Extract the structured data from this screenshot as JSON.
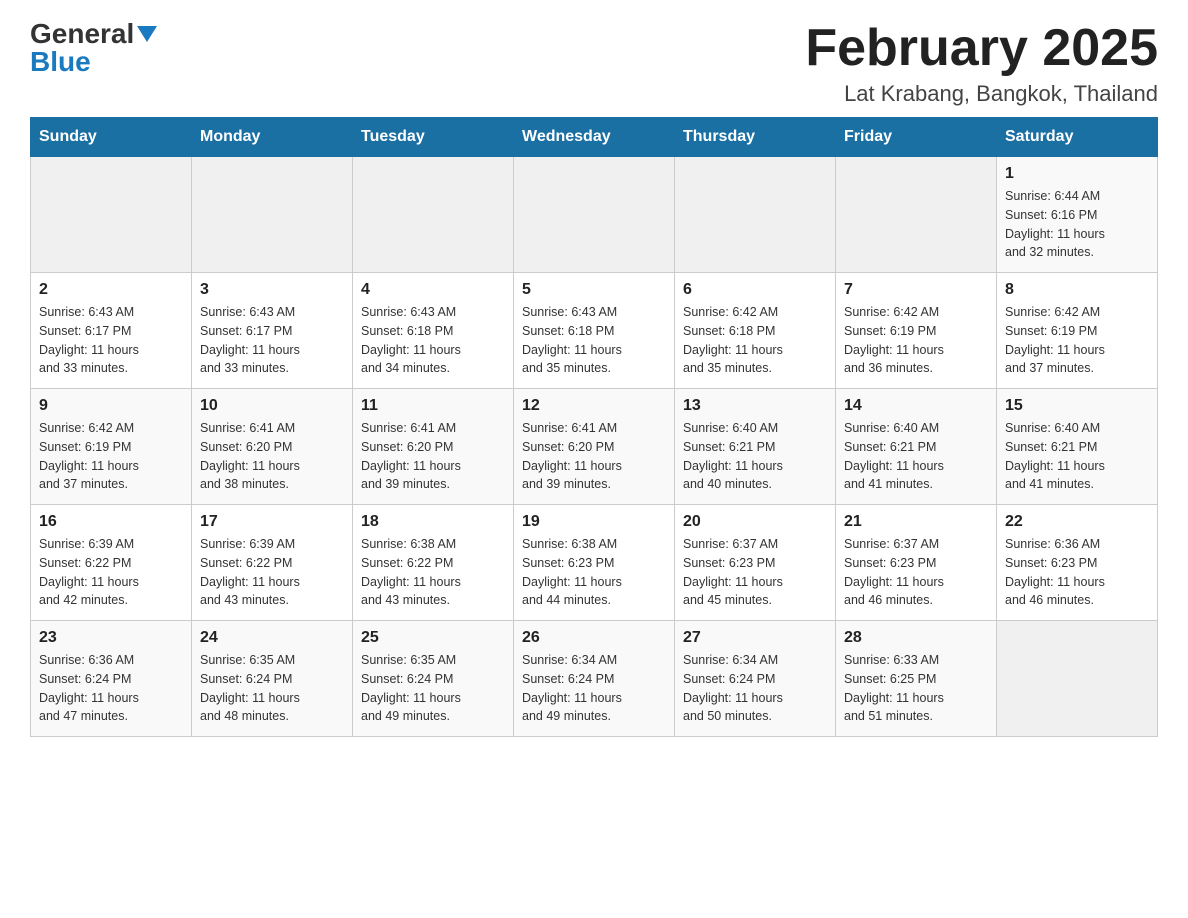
{
  "logo": {
    "general": "General",
    "blue": "Blue"
  },
  "header": {
    "title": "February 2025",
    "location": "Lat Krabang, Bangkok, Thailand"
  },
  "weekdays": [
    "Sunday",
    "Monday",
    "Tuesday",
    "Wednesday",
    "Thursday",
    "Friday",
    "Saturday"
  ],
  "weeks": [
    [
      {
        "day": "",
        "info": ""
      },
      {
        "day": "",
        "info": ""
      },
      {
        "day": "",
        "info": ""
      },
      {
        "day": "",
        "info": ""
      },
      {
        "day": "",
        "info": ""
      },
      {
        "day": "",
        "info": ""
      },
      {
        "day": "1",
        "info": "Sunrise: 6:44 AM\nSunset: 6:16 PM\nDaylight: 11 hours\nand 32 minutes."
      }
    ],
    [
      {
        "day": "2",
        "info": "Sunrise: 6:43 AM\nSunset: 6:17 PM\nDaylight: 11 hours\nand 33 minutes."
      },
      {
        "day": "3",
        "info": "Sunrise: 6:43 AM\nSunset: 6:17 PM\nDaylight: 11 hours\nand 33 minutes."
      },
      {
        "day": "4",
        "info": "Sunrise: 6:43 AM\nSunset: 6:18 PM\nDaylight: 11 hours\nand 34 minutes."
      },
      {
        "day": "5",
        "info": "Sunrise: 6:43 AM\nSunset: 6:18 PM\nDaylight: 11 hours\nand 35 minutes."
      },
      {
        "day": "6",
        "info": "Sunrise: 6:42 AM\nSunset: 6:18 PM\nDaylight: 11 hours\nand 35 minutes."
      },
      {
        "day": "7",
        "info": "Sunrise: 6:42 AM\nSunset: 6:19 PM\nDaylight: 11 hours\nand 36 minutes."
      },
      {
        "day": "8",
        "info": "Sunrise: 6:42 AM\nSunset: 6:19 PM\nDaylight: 11 hours\nand 37 minutes."
      }
    ],
    [
      {
        "day": "9",
        "info": "Sunrise: 6:42 AM\nSunset: 6:19 PM\nDaylight: 11 hours\nand 37 minutes."
      },
      {
        "day": "10",
        "info": "Sunrise: 6:41 AM\nSunset: 6:20 PM\nDaylight: 11 hours\nand 38 minutes."
      },
      {
        "day": "11",
        "info": "Sunrise: 6:41 AM\nSunset: 6:20 PM\nDaylight: 11 hours\nand 39 minutes."
      },
      {
        "day": "12",
        "info": "Sunrise: 6:41 AM\nSunset: 6:20 PM\nDaylight: 11 hours\nand 39 minutes."
      },
      {
        "day": "13",
        "info": "Sunrise: 6:40 AM\nSunset: 6:21 PM\nDaylight: 11 hours\nand 40 minutes."
      },
      {
        "day": "14",
        "info": "Sunrise: 6:40 AM\nSunset: 6:21 PM\nDaylight: 11 hours\nand 41 minutes."
      },
      {
        "day": "15",
        "info": "Sunrise: 6:40 AM\nSunset: 6:21 PM\nDaylight: 11 hours\nand 41 minutes."
      }
    ],
    [
      {
        "day": "16",
        "info": "Sunrise: 6:39 AM\nSunset: 6:22 PM\nDaylight: 11 hours\nand 42 minutes."
      },
      {
        "day": "17",
        "info": "Sunrise: 6:39 AM\nSunset: 6:22 PM\nDaylight: 11 hours\nand 43 minutes."
      },
      {
        "day": "18",
        "info": "Sunrise: 6:38 AM\nSunset: 6:22 PM\nDaylight: 11 hours\nand 43 minutes."
      },
      {
        "day": "19",
        "info": "Sunrise: 6:38 AM\nSunset: 6:23 PM\nDaylight: 11 hours\nand 44 minutes."
      },
      {
        "day": "20",
        "info": "Sunrise: 6:37 AM\nSunset: 6:23 PM\nDaylight: 11 hours\nand 45 minutes."
      },
      {
        "day": "21",
        "info": "Sunrise: 6:37 AM\nSunset: 6:23 PM\nDaylight: 11 hours\nand 46 minutes."
      },
      {
        "day": "22",
        "info": "Sunrise: 6:36 AM\nSunset: 6:23 PM\nDaylight: 11 hours\nand 46 minutes."
      }
    ],
    [
      {
        "day": "23",
        "info": "Sunrise: 6:36 AM\nSunset: 6:24 PM\nDaylight: 11 hours\nand 47 minutes."
      },
      {
        "day": "24",
        "info": "Sunrise: 6:35 AM\nSunset: 6:24 PM\nDaylight: 11 hours\nand 48 minutes."
      },
      {
        "day": "25",
        "info": "Sunrise: 6:35 AM\nSunset: 6:24 PM\nDaylight: 11 hours\nand 49 minutes."
      },
      {
        "day": "26",
        "info": "Sunrise: 6:34 AM\nSunset: 6:24 PM\nDaylight: 11 hours\nand 49 minutes."
      },
      {
        "day": "27",
        "info": "Sunrise: 6:34 AM\nSunset: 6:24 PM\nDaylight: 11 hours\nand 50 minutes."
      },
      {
        "day": "28",
        "info": "Sunrise: 6:33 AM\nSunset: 6:25 PM\nDaylight: 11 hours\nand 51 minutes."
      },
      {
        "day": "",
        "info": ""
      }
    ]
  ]
}
